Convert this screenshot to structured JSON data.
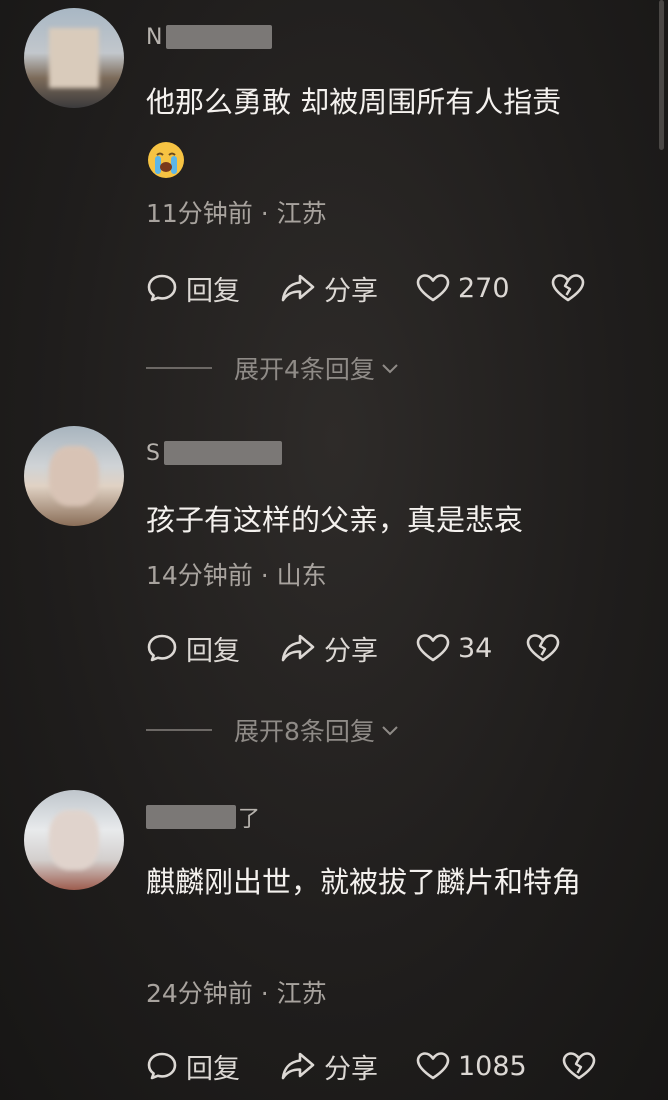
{
  "comments": [
    {
      "username": "N",
      "text": "他那么勇敢 却被周围所有人指责",
      "emoji": "loudly-crying-face",
      "meta": "11分钟前 · 江苏",
      "reply_label": "回复",
      "share_label": "分享",
      "likes": "270",
      "expand_label": "展开4条回复"
    },
    {
      "username": "S",
      "text": "孩子有这样的父亲，真是悲哀",
      "meta": "14分钟前 · 山东",
      "reply_label": "回复",
      "share_label": "分享",
      "likes": "34",
      "expand_label": "展开8条回复"
    },
    {
      "username": "了",
      "text": "麒麟刚出世，就被拔了麟片和特角",
      "meta": "24分钟前 · 江苏",
      "reply_label": "回复",
      "share_label": "分享",
      "likes": "1085"
    }
  ],
  "icons": {
    "reply": "speech-bubble-icon",
    "share": "share-arrow-icon",
    "like": "heart-icon",
    "dislike": "broken-heart-icon",
    "expand": "chevron-down-icon"
  },
  "colors": {
    "background": "#1f1d1c",
    "text": "#f4f1ee",
    "meta": "#a8a39e",
    "action": "#dcd8d4"
  }
}
